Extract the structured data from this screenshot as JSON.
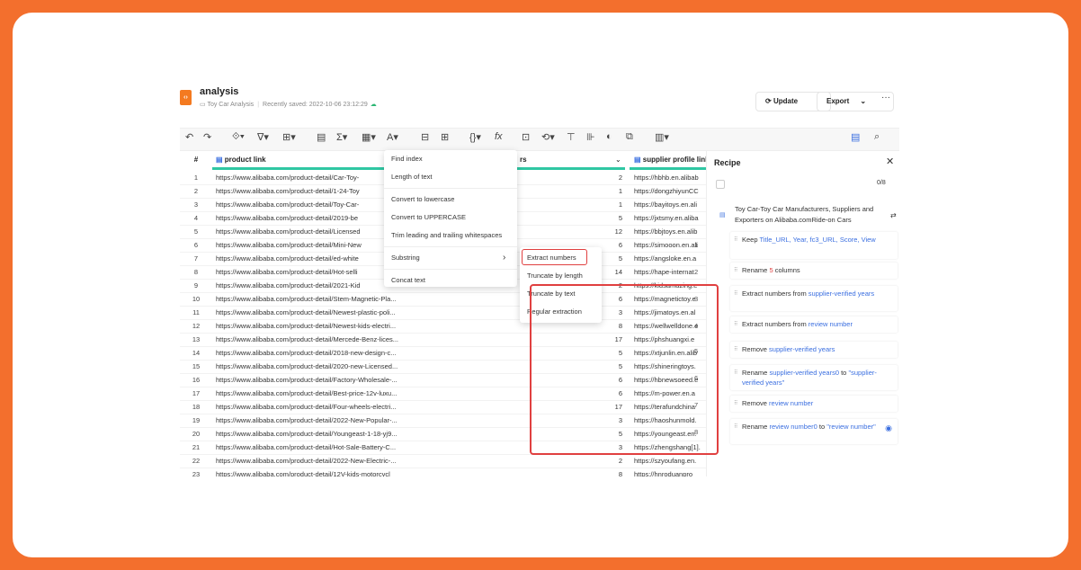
{
  "header": {
    "title": "analysis",
    "breadcrumb": "Toy Car Analysis",
    "saved": "Recently saved: 2022-10-06 23:12:29",
    "update": "Update",
    "export": "Export",
    "more": "···"
  },
  "columns": {
    "num": "#",
    "c1": "product link",
    "c2": "rs",
    "c3": "supplier profile link"
  },
  "rows": [
    {
      "n": "1",
      "link": "https://www.alibaba.com/product-detail/Car-Toy-",
      "v": "2",
      "sup": "https://hbhb.en.alibab"
    },
    {
      "n": "2",
      "link": "https://www.alibaba.com/product-detail/1-24-Toy",
      "v": "1",
      "sup": "https://dongzhiyunCC"
    },
    {
      "n": "3",
      "link": "https://www.alibaba.com/product-detail/Toy-Car-",
      "v": "1",
      "sup": "https://bayitoys.en.ali"
    },
    {
      "n": "4",
      "link": "https://www.alibaba.com/product-detail/2019-be",
      "v": "5",
      "sup": "https://jxtsmy.en.aliba"
    },
    {
      "n": "5",
      "link": "https://www.alibaba.com/product-detail/Licensed",
      "v": "12",
      "sup": "https://bbjtoys.en.alib"
    },
    {
      "n": "6",
      "link": "https://www.alibaba.com/product-detail/Mini-New",
      "v": "6",
      "sup": "https://simooon.en.ali"
    },
    {
      "n": "7",
      "link": "https://www.alibaba.com/product-detail/ed-white",
      "v": "5",
      "sup": "https://angsloke.en.a"
    },
    {
      "n": "8",
      "link": "https://www.alibaba.com/product-detail/Hot-selli",
      "v": "14",
      "sup": "https://hape-internat"
    },
    {
      "n": "9",
      "link": "https://www.alibaba.com/product-detail/2021-Kid",
      "v": "2",
      "sup": "https://kidsamazing.e"
    },
    {
      "n": "10",
      "link": "https://www.alibaba.com/product-detail/Stem-Magnetic-Pla...",
      "v": "6",
      "sup": "https://magnetictoy.e"
    },
    {
      "n": "11",
      "link": "https://www.alibaba.com/product-detail/Newest-plastic-poli...",
      "v": "3",
      "sup": "https://jimatoys.en.al"
    },
    {
      "n": "12",
      "link": "https://www.alibaba.com/product-detail/Newest-kids-electri...",
      "v": "8",
      "sup": "https://wellwelldone.e"
    },
    {
      "n": "13",
      "link": "https://www.alibaba.com/product-detail/Mercede-Benz-lices...",
      "v": "17",
      "sup": "https://phshuangxi.e"
    },
    {
      "n": "14",
      "link": "https://www.alibaba.com/product-detail/2018-new-design-c...",
      "v": "5",
      "sup": "https://xtjunlin.en.alib"
    },
    {
      "n": "15",
      "link": "https://www.alibaba.com/product-detail/2020-new-Licensed...",
      "v": "5",
      "sup": "https://shineringtoys."
    },
    {
      "n": "16",
      "link": "https://www.alibaba.com/product-detail/Factory-Wholesale-...",
      "v": "6",
      "sup": "https://hbnewsoeed.e"
    },
    {
      "n": "17",
      "link": "https://www.alibaba.com/product-detail/Best-price-12v-luxu...",
      "v": "6",
      "sup": "https://m-power.en.a"
    },
    {
      "n": "18",
      "link": "https://www.alibaba.com/product-detail/Four-wheels-electri...",
      "v": "17",
      "sup": "https://terafundchina"
    },
    {
      "n": "19",
      "link": "https://www.alibaba.com/product-detail/2022-New-Popular-...",
      "v": "3",
      "sup": "https://haoshunmold."
    },
    {
      "n": "20",
      "link": "https://www.alibaba.com/product-detail/Youngeast-1-18-yj9...",
      "v": "5",
      "sup": "https://youngeast.en."
    },
    {
      "n": "21",
      "link": "https://www.alibaba.com/product-detail/Hot-Sale-Battery-C...",
      "v": "3",
      "sup": "https://zhengshang[1]."
    },
    {
      "n": "22",
      "link": "https://www.alibaba.com/product-detail/2022-New-Electric-...",
      "v": "2",
      "sup": "https://szyoufang.en."
    },
    {
      "n": "23",
      "link": "https://www.alibaba.com/product-detail/12V-kids-motorcycl",
      "v": "8",
      "sup": "https://hnroduanpro"
    }
  ],
  "menu": {
    "find_index": "Find index",
    "length": "Length of text",
    "lower": "Convert to lowercase",
    "upper": "Convert to UPPERCASE",
    "trim": "Trim leading and trailing whitespaces",
    "substring": "Substring",
    "substring_arrow": "›",
    "concat": "Concat text"
  },
  "submenu": {
    "extract": "Extract numbers",
    "trunc_len": "Truncate by length",
    "trunc_text": "Truncate by text",
    "regex": "Regular extraction"
  },
  "recipe": {
    "title": "Recipe",
    "close": "✕",
    "count": "0/8",
    "source": "Toy Car-Toy Car Manufacturers, Suppliers and Exporters on Alibaba.comRide-on Cars",
    "steps": [
      {
        "n": "1",
        "pre": "Keep",
        "blue": "Title_URL, Year, fc3_URL, Score, View",
        "post": ""
      },
      {
        "n": "2",
        "pre": "Rename",
        "red": "5",
        "post": "columns"
      },
      {
        "n": "3",
        "pre": "Extract numbers from",
        "blue": "supplier-verified years"
      },
      {
        "n": "4",
        "pre": "Extract numbers from",
        "blue": "review number"
      },
      {
        "n": "5",
        "pre": "Remove",
        "blue": "supplier-verified years"
      },
      {
        "n": "6",
        "pre": "Rename",
        "blue": "supplier-verified years0",
        "mid": "to",
        "blue2": "\"supplier-verified years\""
      },
      {
        "n": "7",
        "pre": "Remove",
        "blue": "review number"
      },
      {
        "n": "8",
        "pre": "Rename",
        "blue": "review number0",
        "mid": "to",
        "blue2": "\"review number\""
      }
    ]
  }
}
